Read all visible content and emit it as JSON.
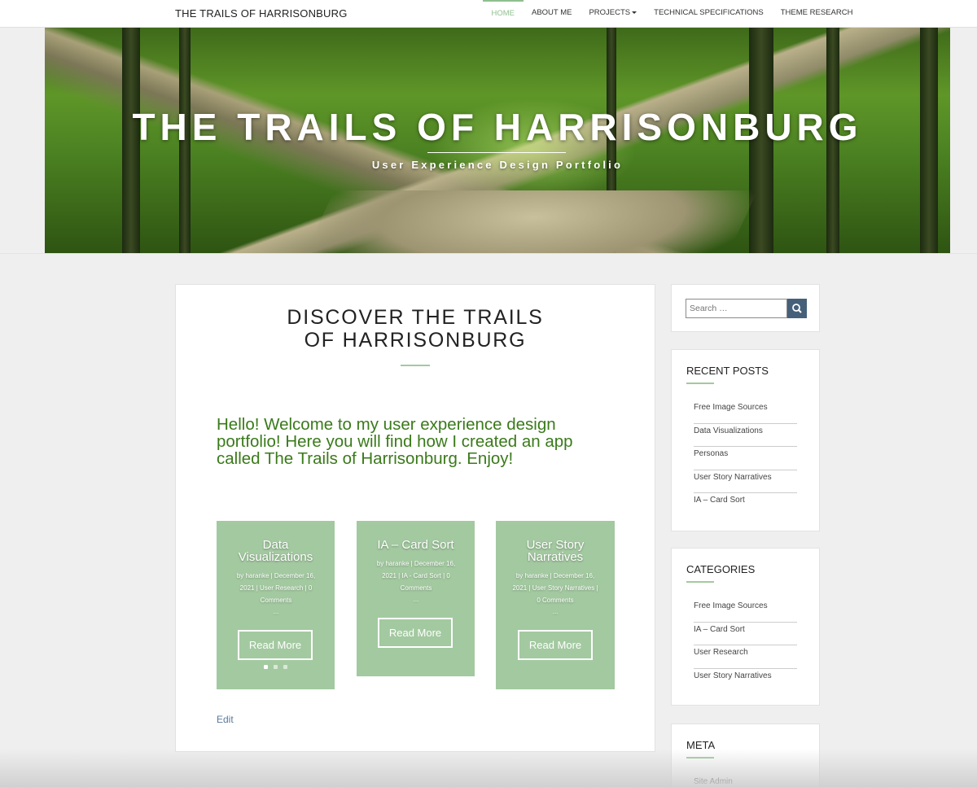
{
  "nav": {
    "brand": "THE TRAILS OF HARRISONBURG",
    "links": [
      "HOME",
      "ABOUT ME",
      "PROJECTS",
      "TECHNICAL SPECIFICATIONS",
      "THEME RESEARCH"
    ]
  },
  "hero": {
    "title": "THE TRAILS OF HARRISONBURG",
    "subtitle": "User Experience Design Portfolio"
  },
  "page": {
    "title": "DISCOVER THE TRAILS OF HARRISONBURG",
    "welcome": "Hello! Welcome to my user experience design portfolio! Here you will find how I created an app called The Trails of Harrisonburg. Enjoy!",
    "edit": "Edit"
  },
  "cards": [
    {
      "title": "Data Visualizations",
      "meta": "by haranke | December 16, 2021 | User Research | 0 Comments",
      "ellipsis": "...",
      "button": "Read More"
    },
    {
      "title": "IA – Card Sort",
      "meta": "by haranke | December 16, 2021 | IA - Card Sort | 0 Comments",
      "ellipsis": "...",
      "button": "Read More"
    },
    {
      "title": "User Story Narratives",
      "meta": "by haranke | December 16, 2021 | User Story Narratives | 0 Comments",
      "ellipsis": "...",
      "button": "Read More"
    }
  ],
  "carousel": {
    "active_index": 0,
    "count": 3
  },
  "search": {
    "placeholder": "Search …"
  },
  "recent_posts": {
    "title": "RECENT POSTS",
    "items": [
      "Free Image Sources",
      "Data Visualizations",
      "Personas",
      "User Story Narratives",
      "IA – Card Sort"
    ]
  },
  "categories": {
    "title": "CATEGORIES",
    "items": [
      "Free Image Sources",
      "IA – Card Sort",
      "User Research",
      "User Story Narratives"
    ]
  },
  "meta": {
    "title": "META",
    "items": [
      "Site Admin"
    ]
  },
  "colors": {
    "accent_green": "#a3c9a0",
    "welcome_text": "#3a7a1a",
    "search_button": "#46607a"
  }
}
